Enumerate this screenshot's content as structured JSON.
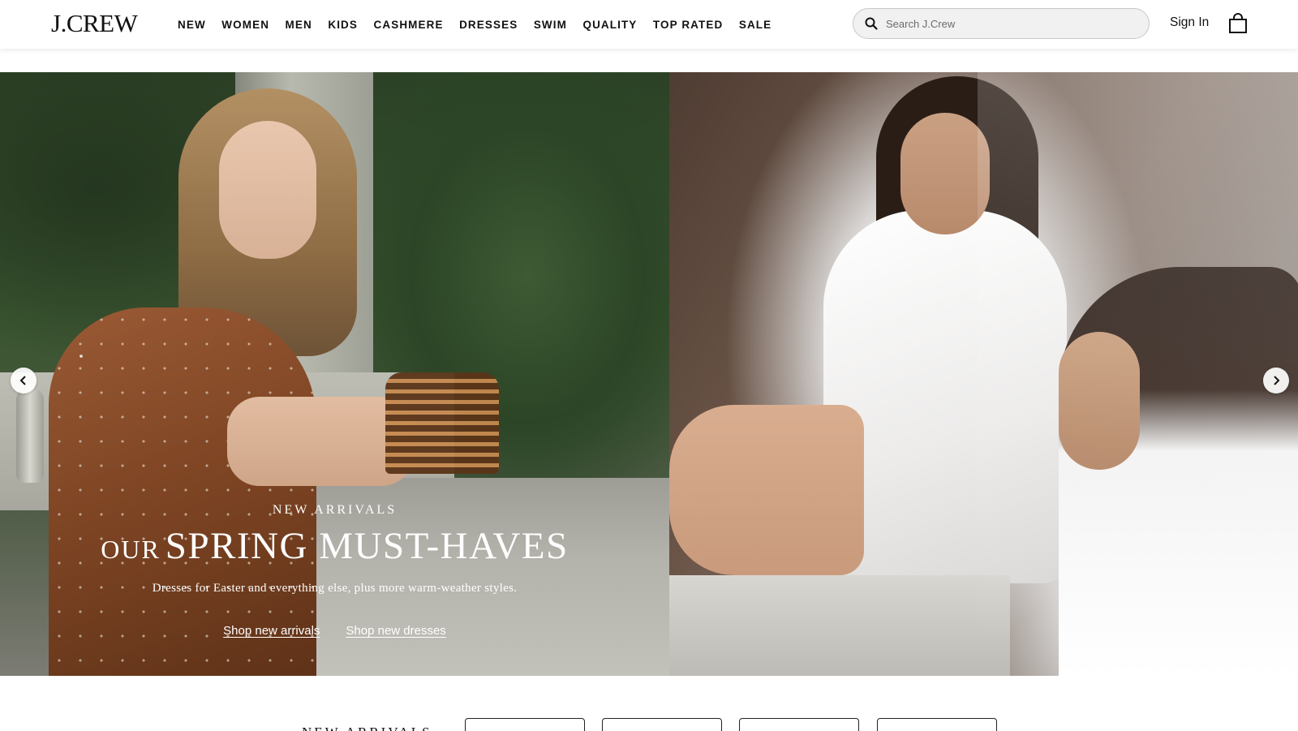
{
  "header": {
    "logo": "J.CREW",
    "nav": [
      "NEW",
      "WOMEN",
      "MEN",
      "KIDS",
      "CASHMERE",
      "DRESSES",
      "SWIM",
      "QUALITY",
      "TOP RATED",
      "SALE"
    ],
    "search_placeholder": "Search J.Crew",
    "sign_in": "Sign In",
    "icons": {
      "search": "search-icon",
      "bag": "shopping-bag-icon"
    }
  },
  "hero": {
    "eyebrow": "NEW ARRIVALS",
    "headline_prefix": "OUR",
    "headline_main": "SPRING MUST-HAVES",
    "subline": "Dresses for Easter and everything else, plus more warm-weather styles.",
    "link_arrivals": "Shop new arrivals",
    "link_dresses": "Shop new dresses",
    "icons": {
      "prev": "chevron-left-icon",
      "next": "chevron-right-icon"
    }
  },
  "category_strip": {
    "title": "NEW ARRIVALS",
    "buttons": [
      "",
      "",
      "",
      ""
    ]
  }
}
